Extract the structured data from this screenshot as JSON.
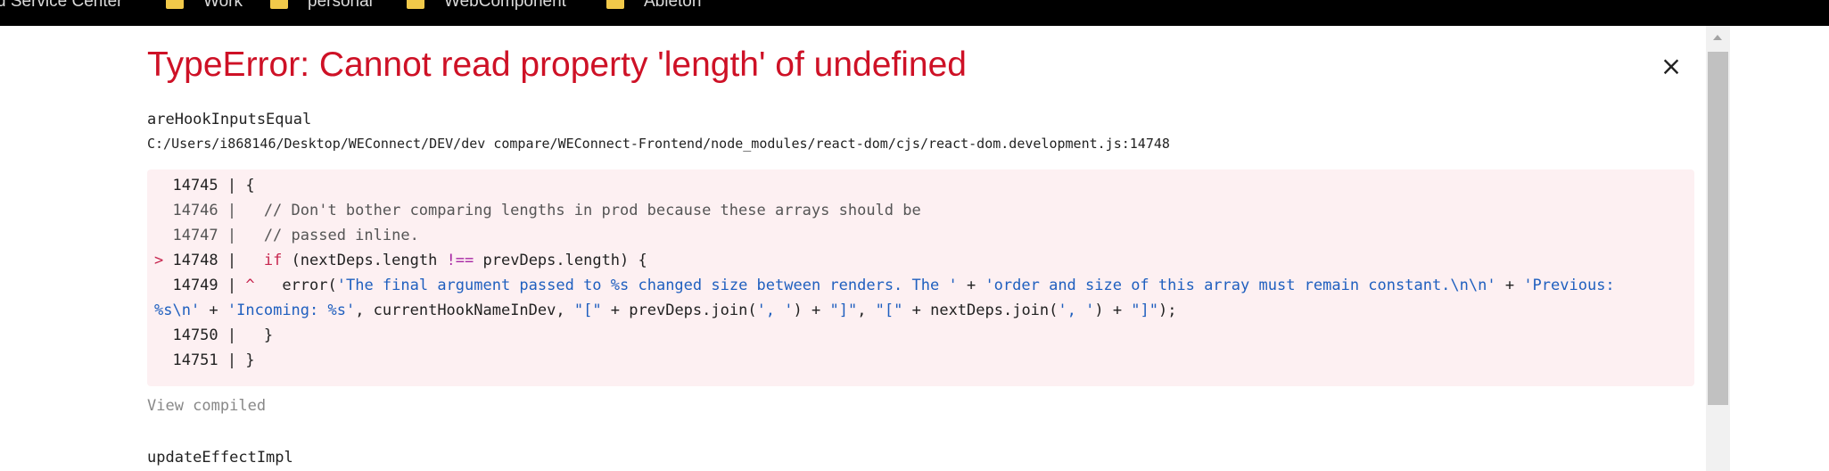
{
  "bookmarks": [
    {
      "label": "d Service Center",
      "has_icon": false
    },
    {
      "label": "Work",
      "has_icon": true
    },
    {
      "label": "personal",
      "has_icon": true
    },
    {
      "label": "WebComponent",
      "has_icon": true
    },
    {
      "label": "Ableton",
      "has_icon": true
    }
  ],
  "error": {
    "title": "TypeError: Cannot read property 'length' of undefined",
    "close_symbol": "×"
  },
  "frame1": {
    "function_name": "areHookInputsEqual",
    "file_path": "C:/Users/i868146/Desktop/WEConnect/DEV/dev compare/WEConnect-Frontend/node_modules/react-dom/cjs/react-dom.development.js:14748",
    "code": {
      "line1": "  14745 | {",
      "line2": "  14746 |   // Don't bother comparing lengths in prod because these arrays should be",
      "line3": "  14747 |   // passed inline.",
      "line4_marker": "> ",
      "line4_gutter": "14748 |   ",
      "line4_kw": "if",
      "line4_a": " (nextDeps.length ",
      "line4_op": "!==",
      "line4_b": " prevDeps.length) {",
      "line5_gutter": "  14749 | ",
      "line5_caret": "^",
      "line5_a": "   error(",
      "line5_s1": "'The final argument passed to %s changed size between renders. The '",
      "line5_p1": " + ",
      "line5_s2": "'order and size of this array must remain constant.\\n\\n'",
      "line5_p2": " + ",
      "line5_s3": "'Previous:",
      "line6_s3": "%s\\n'",
      "line6_p3": " + ",
      "line6_s4": "'Incoming: %s'",
      "line6_a": ", currentHookNameInDev, ",
      "line6_s5": "\"[\"",
      "line6_p4": " + prevDeps.join(",
      "line6_s6": "', '",
      "line6_p5": ") + ",
      "line6_s7": "\"]\"",
      "line6_c": ", ",
      "line6_s8": "\"[\"",
      "line6_p6": " + nextDeps.join(",
      "line6_s9": "', '",
      "line6_p7": ") + ",
      "line6_s10": "\"]\"",
      "line6_end": ");",
      "line7": "  14750 |   }",
      "line8": "  14751 | }"
    },
    "view_compiled": "View compiled"
  },
  "frame2": {
    "function_name": "updateEffectImpl"
  },
  "colors": {
    "title_red": "#ce1126",
    "code_bg": "#fdf0f2",
    "string_blue": "#1f5fbf",
    "keyword_red": "#c7254e",
    "folder_yellow": "#f1c94a"
  }
}
